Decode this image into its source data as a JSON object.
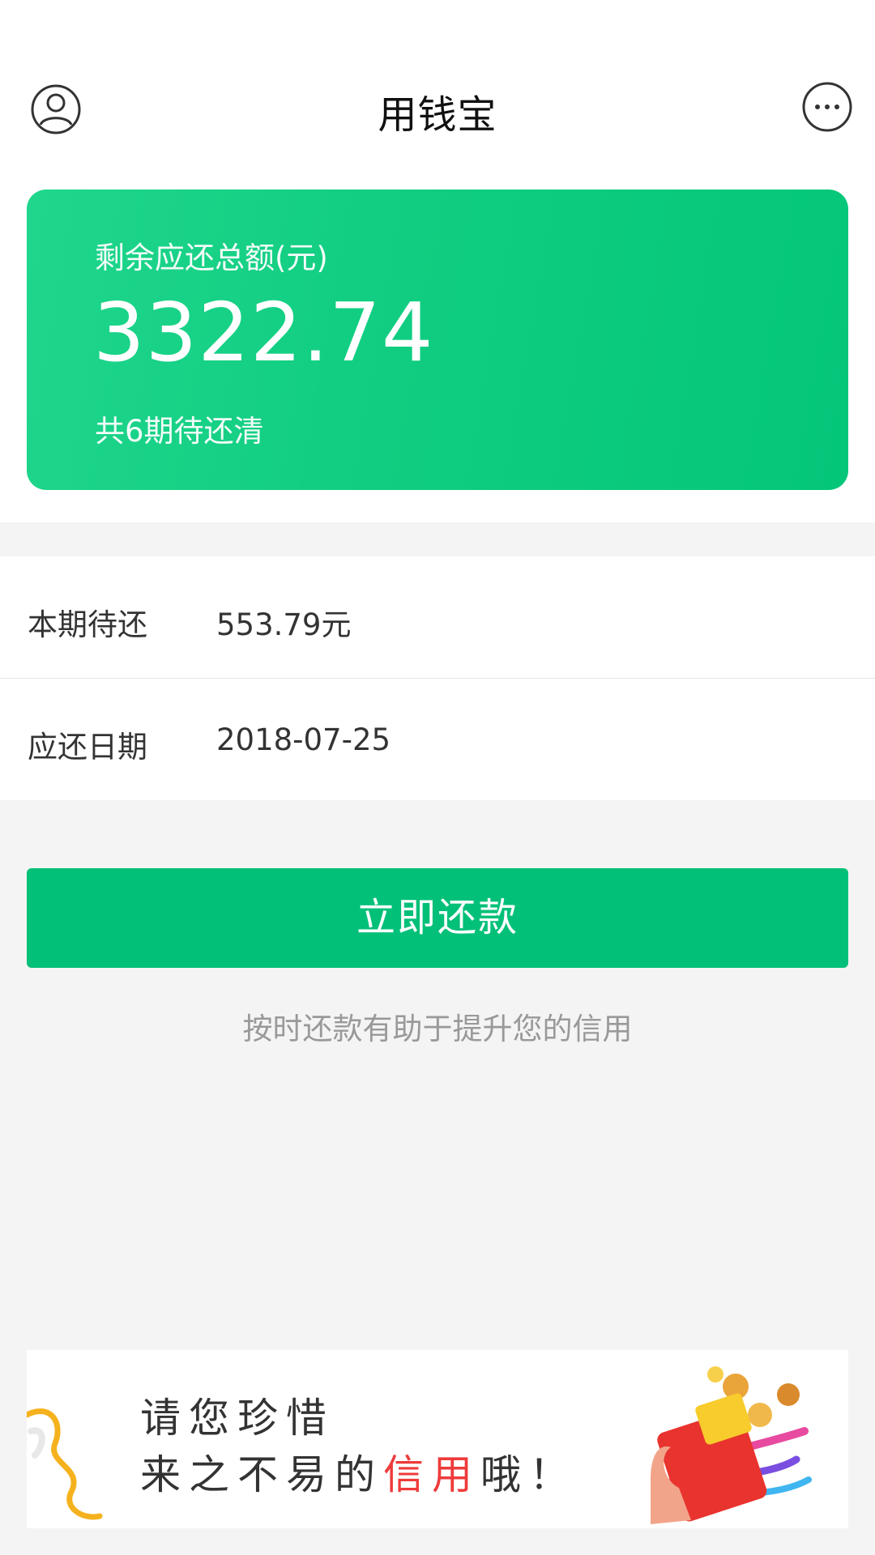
{
  "header": {
    "title": "用钱宝",
    "user_icon": "user-circle-icon",
    "more_icon": "more-dots-icon"
  },
  "summary": {
    "label": "剩余应还总额(元)",
    "amount": "3322.74",
    "periods_text": "共6期待还清"
  },
  "details": {
    "current_due_label": "本期待还",
    "current_due_value": "553.79元",
    "due_date_label": "应还日期",
    "due_date_value": "2018-07-25"
  },
  "actions": {
    "pay_now_label": "立即还款"
  },
  "hint": "按时还款有助于提升您的信用",
  "banner": {
    "line1": "请您珍惜",
    "line2_prefix": "来之不易的",
    "line2_highlight": "信用",
    "line2_suffix": "哦！"
  },
  "colors": {
    "primary_green": "#03c078",
    "card_gradient_start": "#1fd68c",
    "card_gradient_end": "#04c679",
    "highlight_red": "#ee3b3b"
  }
}
